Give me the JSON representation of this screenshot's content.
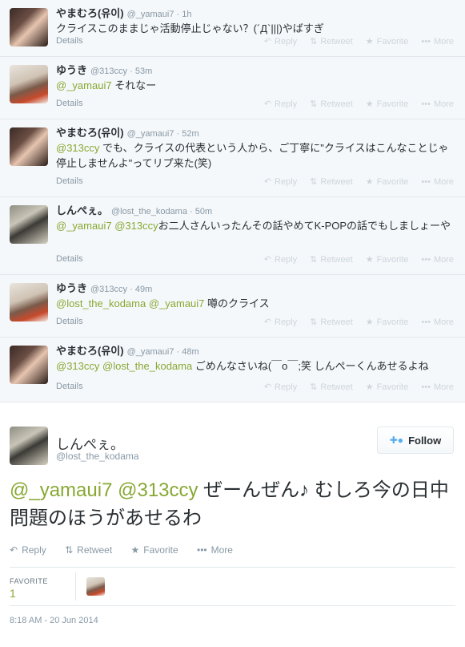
{
  "thread": [
    {
      "name": "やまむろ(유이)",
      "handle": "@_yamaui7",
      "time": "1h",
      "avatar": "yamamuro",
      "text_pre": "",
      "mentions": [],
      "text": "クライスこのままじゃ活動停止じゃない？(´Д`|||)やばすぎ",
      "details": "Details"
    },
    {
      "name": "ゆうき",
      "handle": "@313ccy",
      "time": "53m",
      "avatar": "yuuki",
      "mentions": [
        "@_yamaui7"
      ],
      "text": " それなー",
      "details": "Details"
    },
    {
      "name": "やまむろ(유이)",
      "handle": "@_yamaui7",
      "time": "52m",
      "avatar": "yamamuro",
      "mentions": [
        "@313ccy"
      ],
      "text": " でも、クライスの代表という人から、ご丁寧に\"クライスはこんなことじゃ停止しませんよ\"ってリプ来た(笑)",
      "details": "Details"
    },
    {
      "name": "しんぺぇ。",
      "handle": "@lost_the_kodama",
      "time": "50m",
      "avatar": "shinpe",
      "mentions": [
        "@_yamaui7",
        "@313ccy"
      ],
      "text": "お二人さんいったんその話やめてK-POPの話でもしましょーや",
      "details": "Details"
    },
    {
      "name": "ゆうき",
      "handle": "@313ccy",
      "time": "49m",
      "avatar": "yuuki",
      "mentions": [
        "@lost_the_kodama",
        "@_yamaui7"
      ],
      "text": " 噂のクライス",
      "details": "Details"
    },
    {
      "name": "やまむろ(유이)",
      "handle": "@_yamaui7",
      "time": "48m",
      "avatar": "yamamuro",
      "mentions": [
        "@313ccy",
        "@lost_the_kodama"
      ],
      "text": " ごめんなさいね(￣o￣;笑 しんぺーくんあせるよね",
      "details": "Details"
    }
  ],
  "actions": {
    "reply": "Reply",
    "retweet": "Retweet",
    "favorite": "Favorite",
    "more": "More"
  },
  "main_tweet": {
    "name": "しんぺぇ。",
    "handle": "@lost_the_kodama",
    "follow_label": "Follow",
    "mentions": [
      "@_yamaui7",
      "@313ccy"
    ],
    "text": " ぜーんぜん♪ むしろ今の日中問題のほうがあせるわ",
    "favorite_label": "FAVORITE",
    "favorite_count": "1",
    "timestamp": "8:18 AM - 20 Jun 2014"
  },
  "colors": {
    "mention": "#88a833",
    "muted": "#8899a6",
    "bg": "#f5f8fa",
    "border": "#e1e8ed",
    "follow_icon": "#55acee"
  },
  "icons": {
    "reply": "reply-arrow-icon",
    "retweet": "retweet-icon",
    "favorite": "star-icon",
    "more": "ellipsis-icon",
    "follow": "add-user-icon"
  }
}
